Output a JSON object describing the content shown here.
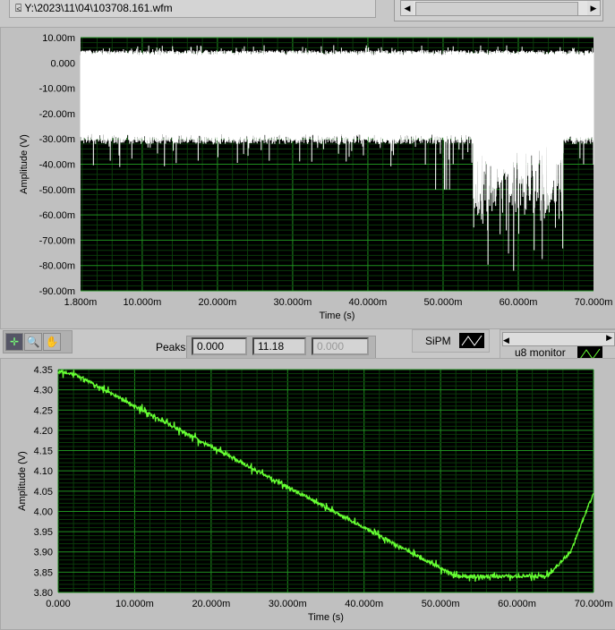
{
  "file_path": "Y:\\2023\\11\\04\\103708.161.wfm",
  "graph1": {
    "ylabel": "Amplitude (V)",
    "xlabel": "Time (s)",
    "yticks": [
      "10.00m",
      "0.000",
      "-10.00m",
      "-20.00m",
      "-30.00m",
      "-40.00m",
      "-50.00m",
      "-60.00m",
      "-70.00m",
      "-80.00m",
      "-90.00m"
    ],
    "xticks": [
      "1.800m",
      "10.000m",
      "20.000m",
      "30.000m",
      "40.000m",
      "50.000m",
      "60.000m",
      "70.000m"
    ]
  },
  "toolbar": {
    "peaks_label": "Peaks",
    "peak_values": [
      "0.000",
      "11.18",
      "0.000"
    ],
    "legend_sipm": "SiPM",
    "legend_monitor": "u8 monitor"
  },
  "graph2": {
    "ylabel": "Amplitude (V)",
    "xlabel": "Time (s)",
    "yticks": [
      "4.35",
      "4.30",
      "4.25",
      "4.20",
      "4.15",
      "4.10",
      "4.05",
      "4.00",
      "3.95",
      "3.90",
      "3.85",
      "3.80"
    ],
    "xticks": [
      "0.000",
      "10.000m",
      "20.000m",
      "30.000m",
      "40.000m",
      "50.000m",
      "60.000m",
      "70.000m"
    ]
  },
  "chart_data": [
    {
      "type": "line",
      "title": "SiPM",
      "xlabel": "Time (s)",
      "ylabel": "Amplitude (V)",
      "xlim": [
        0.0018,
        0.07
      ],
      "ylim": [
        -0.09,
        0.01
      ],
      "color": "#ffffff",
      "description_values": {
        "upper_envelope": 0.004,
        "lower_envelope": -0.03,
        "min_spike": -0.085
      }
    },
    {
      "type": "line",
      "title": "u8 monitor",
      "xlabel": "Time (s)",
      "ylabel": "Amplitude (V)",
      "xlim": [
        0,
        0.07
      ],
      "ylim": [
        3.8,
        4.35
      ],
      "color": "#66ff33",
      "x": [
        0,
        0.002,
        0.052,
        0.064,
        0.067,
        0.07
      ],
      "y": [
        4.345,
        4.34,
        3.84,
        3.84,
        3.9,
        4.045
      ]
    }
  ]
}
